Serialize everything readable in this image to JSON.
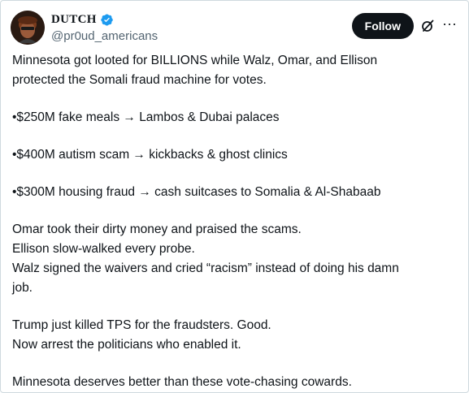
{
  "author": {
    "display_name": "DUTCH",
    "handle": "@pr0ud_americans",
    "verified": true,
    "verified_color": "#1d9bf0",
    "avatar_icon": "avatar-image"
  },
  "actions": {
    "follow_label": "Follow",
    "grok_icon": "grok-icon",
    "more_icon": "more-icon",
    "more_glyph": "···"
  },
  "tweet": {
    "lines": [
      "Minnesota got looted for BILLIONS while Walz, Omar, and Ellison",
      "protected the Somali fraud machine for votes.",
      "•$250M fake meals → Lambos & Dubai palaces",
      "•$400M autism scam → kickbacks & ghost clinics",
      "•$300M housing fraud → cash suitcases to Somalia & Al-Shabaab",
      "Omar took their dirty money and praised the scams.",
      "Ellison slow-walked every probe.",
      "Walz signed the waivers and cried “racism” instead of doing his damn",
      "job.",
      "Trump just killed TPS for the fraudsters. Good.",
      "Now arrest the politicians who enabled it.",
      "Minnesota deserves better than these vote-chasing cowards."
    ]
  },
  "colors": {
    "text": "#0f1419",
    "secondary": "#536471",
    "follow_bg": "#0f1419",
    "follow_text": "#ffffff",
    "border": "#cfd9de"
  }
}
